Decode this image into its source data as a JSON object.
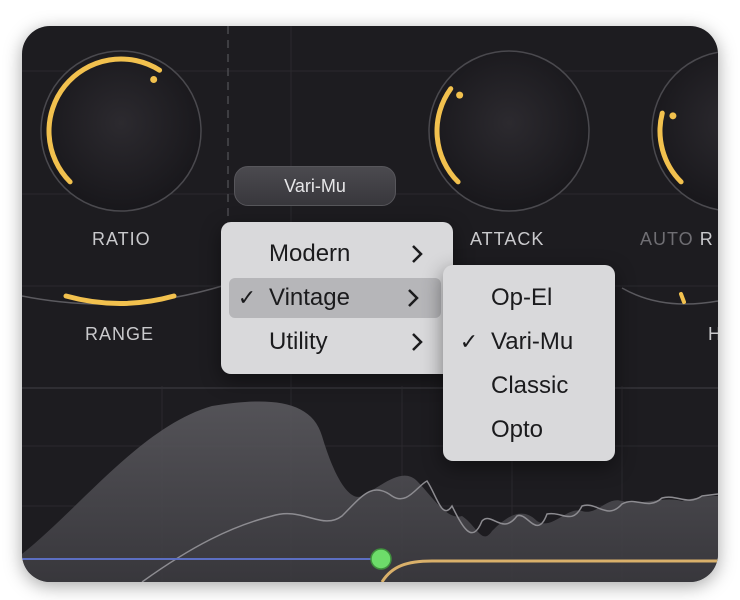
{
  "knobs": [
    {
      "label": "RATIO",
      "level": 0.62
    },
    {
      "label": "ATTACK",
      "level": 0.3
    },
    {
      "label_a": "AUTO",
      "label_b": "R",
      "level": 0.22
    }
  ],
  "range_label": "RANGE",
  "partial_label_right": "H",
  "mode_button": {
    "label": "Vari-Mu"
  },
  "category_menu": {
    "items": [
      {
        "label": "Modern",
        "checked": false
      },
      {
        "label": "Vintage",
        "checked": true
      },
      {
        "label": "Utility",
        "checked": false
      }
    ]
  },
  "style_submenu": {
    "items": [
      {
        "label": "Op-El",
        "checked": false
      },
      {
        "label": "Vari-Mu",
        "checked": true
      },
      {
        "label": "Classic",
        "checked": false
      },
      {
        "label": "Opto",
        "checked": false
      }
    ]
  },
  "check_glyph": "✓",
  "colors": {
    "accent": "#f2c14e",
    "panel_bg": "#1d1c20",
    "menu_bg": "#d9d9db",
    "menu_highlight": "#b6b6b9",
    "node_green": "#6ddc6a"
  }
}
